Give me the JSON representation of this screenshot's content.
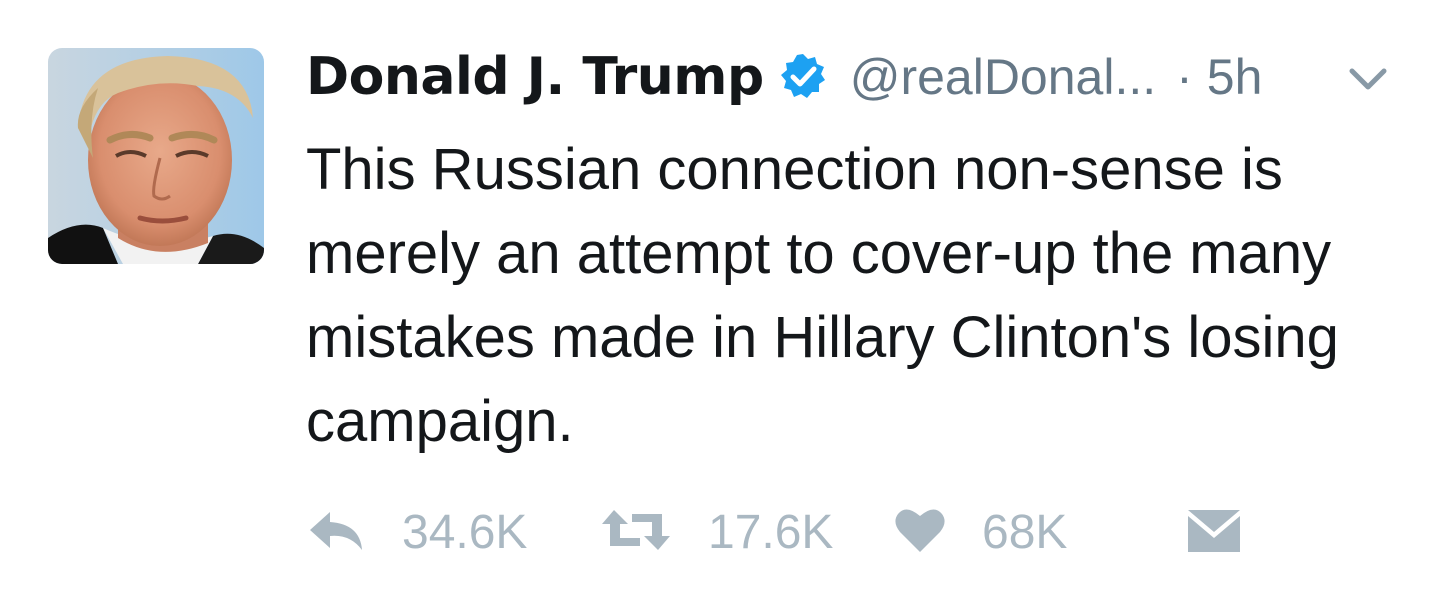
{
  "tweet": {
    "author_name": "Donald J. Trump",
    "handle": "@realDonal...",
    "separator": "·",
    "time": "5h",
    "text": "This Russian connection non-sense is merely an attempt to cover-up the many mistakes made in Hillary Clinton's losing campaign.",
    "actions": {
      "reply_count": "34.6K",
      "retweet_count": "17.6K",
      "like_count": "68K"
    }
  },
  "colors": {
    "text": "#14171a",
    "secondary": "#657786",
    "action_gray": "#aab8c2",
    "verified_blue": "#1da1f2"
  },
  "icons": {
    "verified": "verified-badge-icon",
    "menu": "chevron-down-icon",
    "reply": "reply-icon",
    "retweet": "retweet-icon",
    "like": "heart-icon",
    "dm": "envelope-icon"
  }
}
